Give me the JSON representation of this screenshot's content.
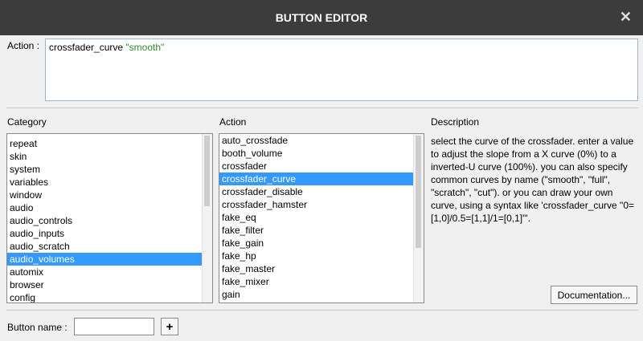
{
  "window": {
    "title": "BUTTON EDITOR",
    "close_glyph": "✕"
  },
  "action_field": {
    "label": "Action :",
    "command": "crossfader_curve",
    "argument": "\"smooth\""
  },
  "category_panel": {
    "header": "Category",
    "items": [
      "repeat",
      "skin",
      "system",
      "variables",
      "window",
      "audio",
      "audio_controls",
      "audio_inputs",
      "audio_scratch",
      "audio_volumes",
      "automix",
      "browser",
      "config"
    ],
    "selected": "audio_volumes"
  },
  "action_panel": {
    "header": "Action",
    "items": [
      "auto_crossfade",
      "booth_volume",
      "crossfader",
      "crossfader_curve",
      "crossfader_disable",
      "crossfader_hamster",
      "fake_eq",
      "fake_filter",
      "fake_gain",
      "fake_hp",
      "fake_master",
      "fake_mixer",
      "gain"
    ],
    "selected": "crossfader_curve"
  },
  "description_panel": {
    "header": "Description",
    "text": "select the curve of the crossfader. enter a value to adjust the slope from a X curve (0%) to a inverted-U curve (100%). you can also specify common curves by name (\"smooth\", \"full\", \"scratch\", \"cut\"). or you can draw your own curve, using a syntax like 'crossfader_curve \"0=[1,0]/0.5=[1,1]/1=[0,1]\"'.",
    "documentation_button": "Documentation..."
  },
  "button_name": {
    "label": "Button name :",
    "value": "",
    "add_glyph": "+"
  },
  "colors": {
    "titlebar": "#3c3c3c",
    "selection": "#3399ff",
    "string_literal": "#2e8b2e"
  }
}
